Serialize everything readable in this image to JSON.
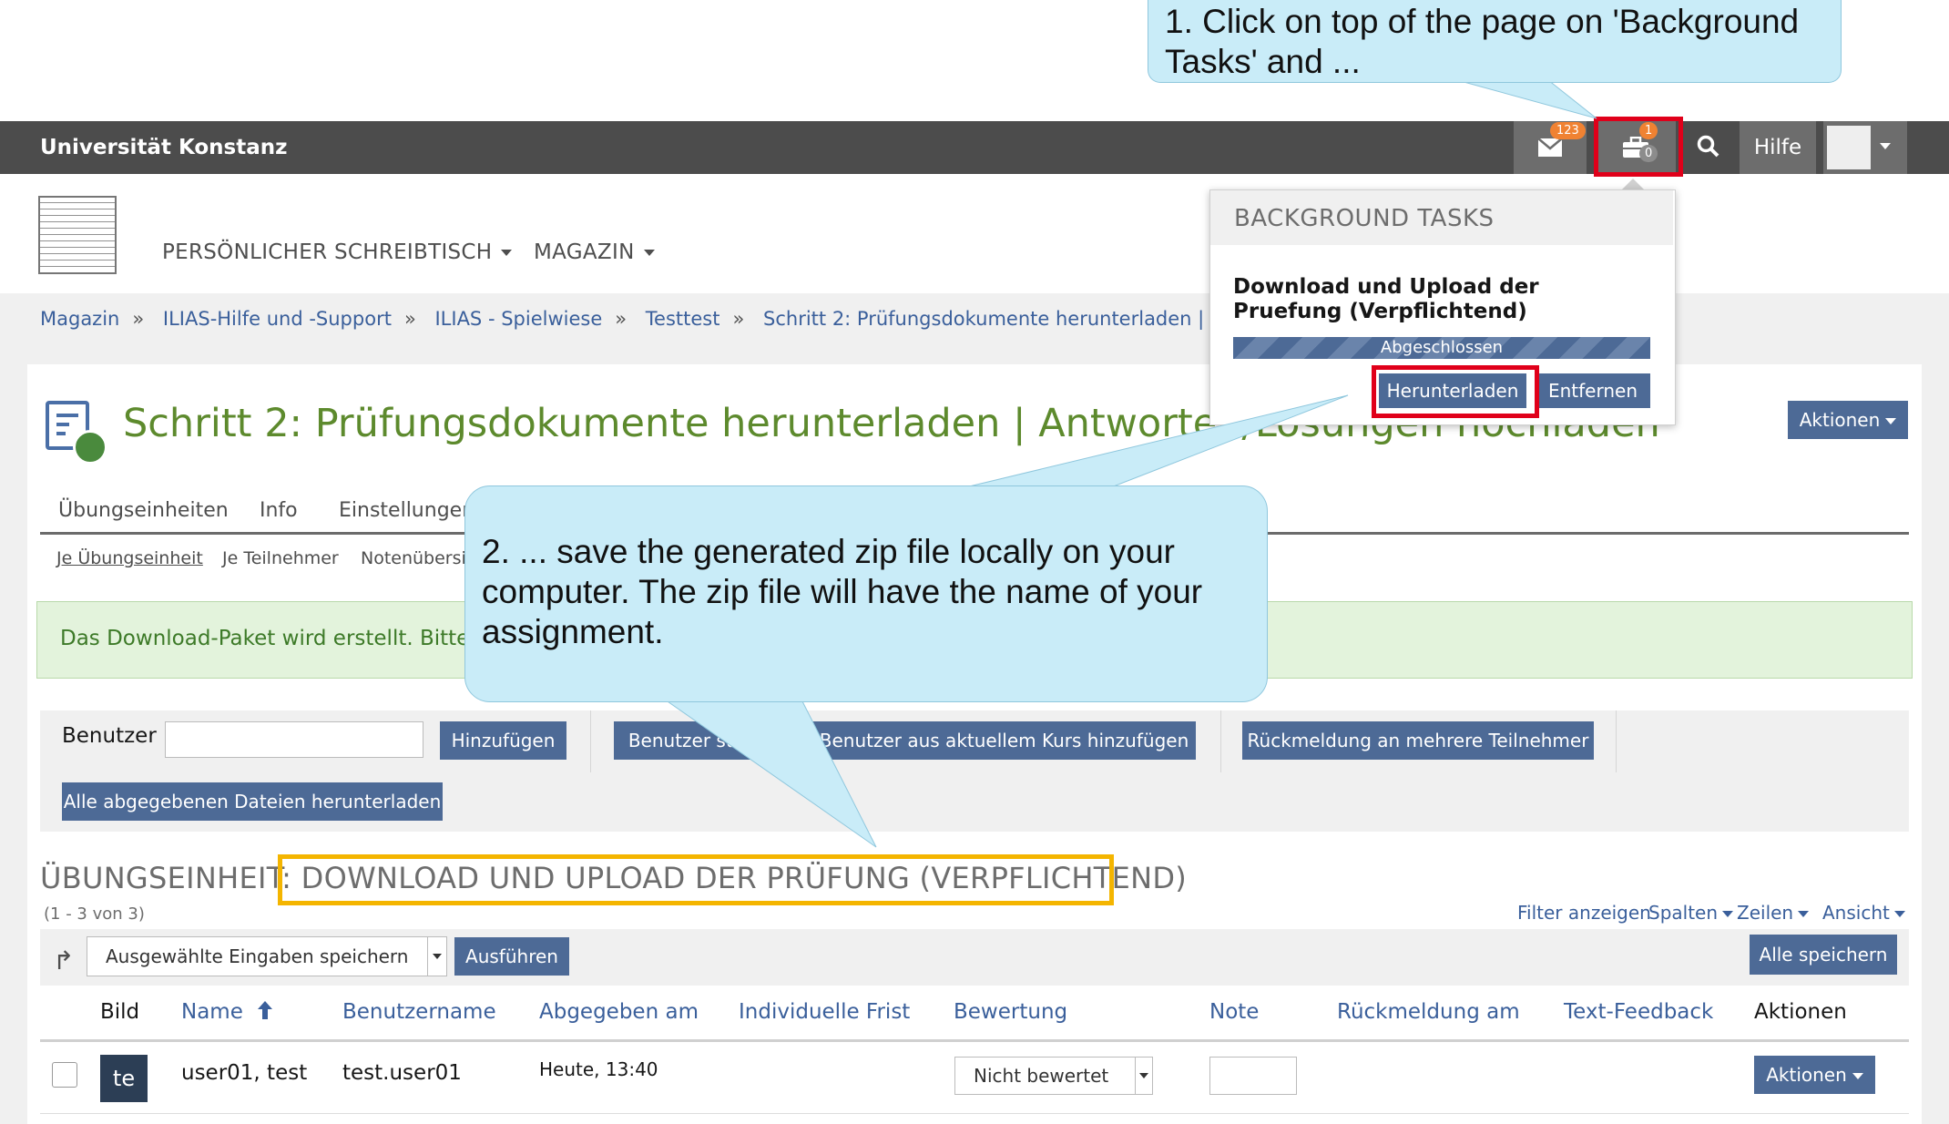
{
  "callouts": {
    "step1": "1. Click on top of the page on 'Background Tasks' and ...",
    "step2": "2. ... save the generated zip file locally on your computer. The zip file will have the name of your assignment."
  },
  "topbar": {
    "brand": "Universität Konstanz",
    "mail_badge": "123",
    "tasks_badge_active": "1",
    "tasks_badge_done": "0",
    "help": "Hilfe"
  },
  "mainnav": {
    "desk": "PERSÖNLICHER SCHREIBTISCH",
    "magazine": "MAGAZIN"
  },
  "breadcrumb": [
    "Magazin",
    "ILIAS-Hilfe und -Support",
    "ILIAS - Spielwiese",
    "Testtest",
    "Schritt 2: Prüfungsdokumente herunterladen | Antworten/Lösungen hochladen"
  ],
  "page_title": "Schritt 2: Prüfungsdokumente herunterladen | Antworten/Lösungen hochladen",
  "actions_label": "Aktionen",
  "tabs": [
    "Übungseinheiten",
    "Info",
    "Einstellungen"
  ],
  "subtabs": [
    "Je Übungseinheit",
    "Je Teilnehmer",
    "Notenübersicht"
  ],
  "success_message": "Das Download-Paket wird erstellt. Bitte überprüfen Sie die Hintergrund-Aufgaben.",
  "toolbar": {
    "user_label": "Benutzer",
    "add": "Hinzufügen",
    "search_users": "Benutzer suchen",
    "add_from_course": "Benutzer aus aktuellem Kurs hinzufügen",
    "feedback_multiple": "Rückmeldung an mehrere Teilnehmer",
    "download_all": "Alle abgegebenen Dateien herunterladen"
  },
  "exercise": {
    "prefix": "ÜBUNGSEINHEIT:",
    "name": "DOWNLOAD UND UPLOAD DER PRÜFUNG (VERPFLICHTEND)",
    "count": "(1 - 3 von 3)"
  },
  "table_controls": [
    "Filter anzeigen",
    "Spalten",
    "Zeilen",
    "Ansicht"
  ],
  "bulk": {
    "select_value": "Ausgewählte Eingaben speichern",
    "execute": "Ausführen",
    "save_all": "Alle speichern"
  },
  "columns": [
    "Bild",
    "Name",
    "Benutzername",
    "Abgegeben am",
    "Individuelle Frist",
    "Bewertung",
    "Note",
    "Rückmeldung am",
    "Text-Feedback",
    "Aktionen"
  ],
  "rows": [
    {
      "avatar": "te",
      "name": "user01, test",
      "username": "test.user01",
      "submitted": "Heute, 13:40",
      "rating": "Nicht bewertet",
      "actions": "Aktionen"
    }
  ],
  "background_tasks": {
    "heading": "BACKGROUND TASKS",
    "task_title": "Download und Upload der Pruefung (Verpflichtend)",
    "status": "Abgeschlossen",
    "progress_fraction": 1.0,
    "download": "Herunterladen",
    "remove": "Entfernen"
  },
  "colors": {
    "accent": "#4d6a96",
    "title_green": "#5d8a2d",
    "highlight_red": "#e0001a",
    "highlight_yellow": "#f4b500",
    "callout_bg": "#c9ecf8"
  }
}
